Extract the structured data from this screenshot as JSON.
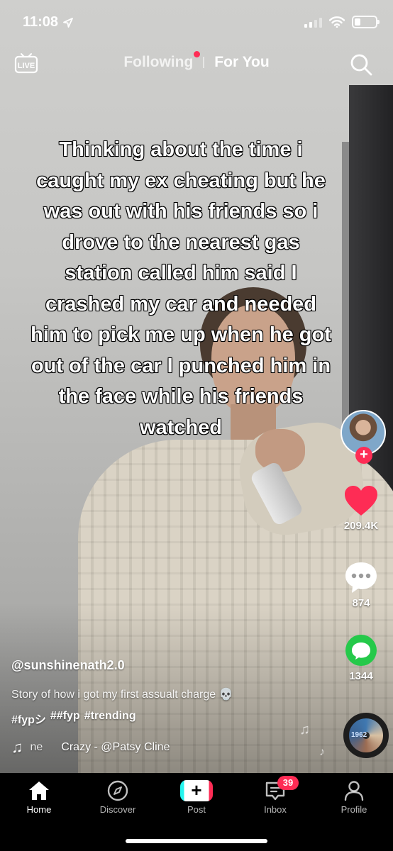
{
  "status_bar": {
    "time": "11:08",
    "icons": [
      "location-arrow-icon",
      "signal-icon",
      "wifi-icon",
      "battery-icon"
    ]
  },
  "top_nav": {
    "live_label": "LIVE",
    "tabs": [
      {
        "label": "Following",
        "active": false,
        "has_dot": true
      },
      {
        "label": "For You",
        "active": true
      }
    ]
  },
  "video": {
    "overlay_text": "Thinking about the time i caught my ex cheating but he was out with his friends so i drove to the nearest gas station called him said I crashed my car and needed him to pick me up when he got out of the car I punched him in the face while his friends watched"
  },
  "rail": {
    "likes": "209.4K",
    "comments": "874",
    "shares": "1344",
    "disc_text": "1962"
  },
  "post": {
    "username": "@sunshinenath2.0",
    "description": "Story of how i got my first assualt charge 💀",
    "hashtags": [
      "#fypシ",
      "##fyp",
      "#trending"
    ],
    "sound_partial": "ne",
    "sound": "Crazy - @Patsy Cline"
  },
  "bottom_nav": {
    "items": [
      {
        "label": "Home",
        "active": true
      },
      {
        "label": "Discover"
      },
      {
        "label": "Post"
      },
      {
        "label": "Inbox",
        "badge": "39"
      },
      {
        "label": "Profile"
      }
    ]
  },
  "colors": {
    "accent": "#fe2c55",
    "teal": "#25f4ee",
    "share_green": "#25c94a"
  }
}
